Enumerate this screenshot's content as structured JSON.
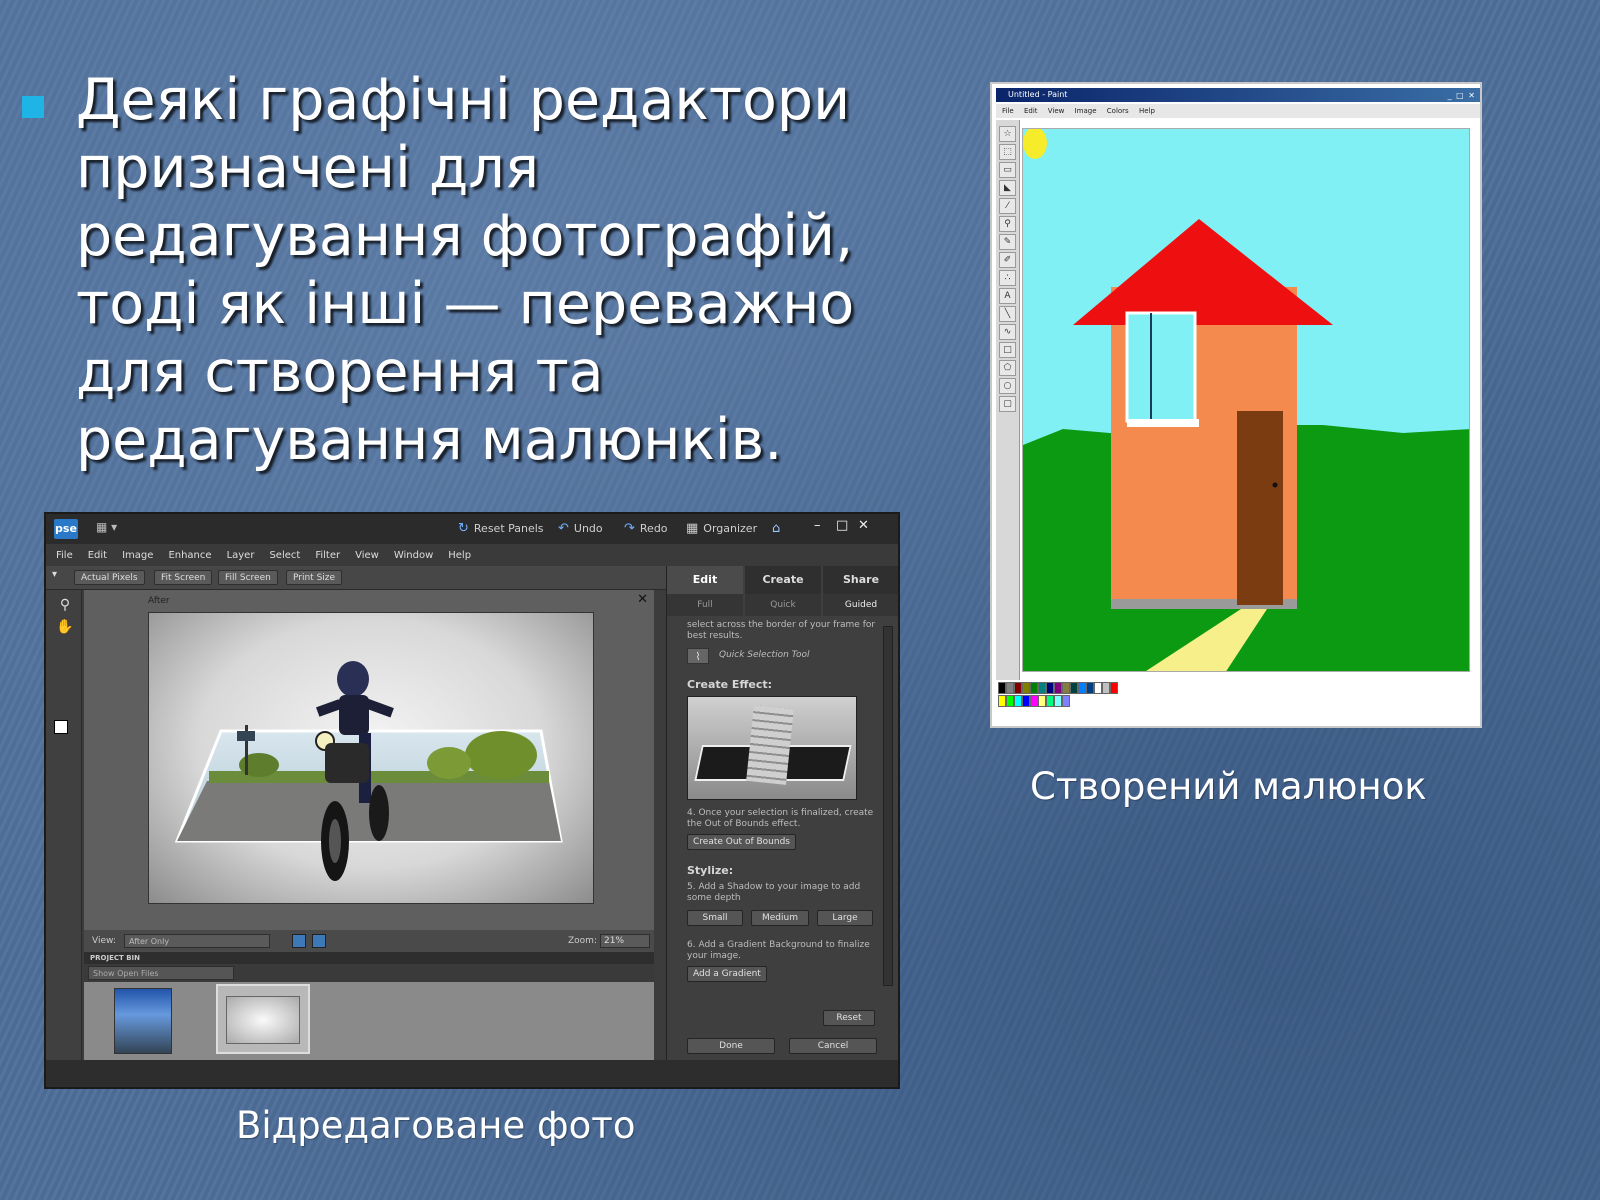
{
  "slide": {
    "headline": "Деякі графічні редактори призначені для редагування фотографій, тоді як інші — переважно для створення та редагування малюнків.",
    "caption_left": "Відредаговане фото",
    "caption_right": "Створений малюнок",
    "bullet_color": "#1fb4e6",
    "background_color": "#4e6f9a"
  },
  "pse": {
    "logo": "pse",
    "toolbar": {
      "reset_panels": "Reset Panels",
      "undo": "Undo",
      "redo": "Redo",
      "organizer": "Organizer"
    },
    "menu": [
      "File",
      "Edit",
      "Image",
      "Enhance",
      "Layer",
      "Select",
      "Filter",
      "View",
      "Window",
      "Help"
    ],
    "options": {
      "actual_pixels": "Actual Pixels",
      "fit_screen": "Fit Screen",
      "fill_screen": "Fill Screen",
      "print_size": "Print Size"
    },
    "document": {
      "label": "After"
    },
    "view_bar": {
      "view_label": "View:",
      "view_value": "After Only",
      "zoom_label": "Zoom:",
      "zoom_value": "21%"
    },
    "project_bin": {
      "title": "PROJECT BIN",
      "filter": "Show Open Files"
    },
    "panel": {
      "tabs": [
        "Edit",
        "Create",
        "Share"
      ],
      "subtabs": [
        "Full",
        "Quick",
        "Guided"
      ],
      "intro_text": "select across the border of your frame for best results.",
      "tool_name": "Quick Selection Tool",
      "create_effect": "Create Effect:",
      "step4": "4. Once your selection is finalized, create the Out of Bounds effect.",
      "create_oob": "Create Out of Bounds",
      "stylize": "Stylize:",
      "step5": "5. Add a Shadow to your image to add some depth",
      "small": "Small",
      "medium": "Medium",
      "large": "Large",
      "step6": "6. Add a Gradient Background to finalize your image.",
      "add_gradient": "Add a Gradient",
      "reset": "Reset",
      "done": "Done",
      "cancel": "Cancel"
    }
  },
  "paint": {
    "title": "Untitled - Paint",
    "menu": [
      "File",
      "Edit",
      "View",
      "Image",
      "Colors",
      "Help"
    ],
    "colors": {
      "sky": "#80f0f4",
      "grass": "#0c9a12",
      "roof": "#ee1010",
      "wall": "#f58a4e",
      "door": "#7a3c10",
      "path": "#f6ef8a",
      "sun": "#f6ec2a"
    }
  }
}
